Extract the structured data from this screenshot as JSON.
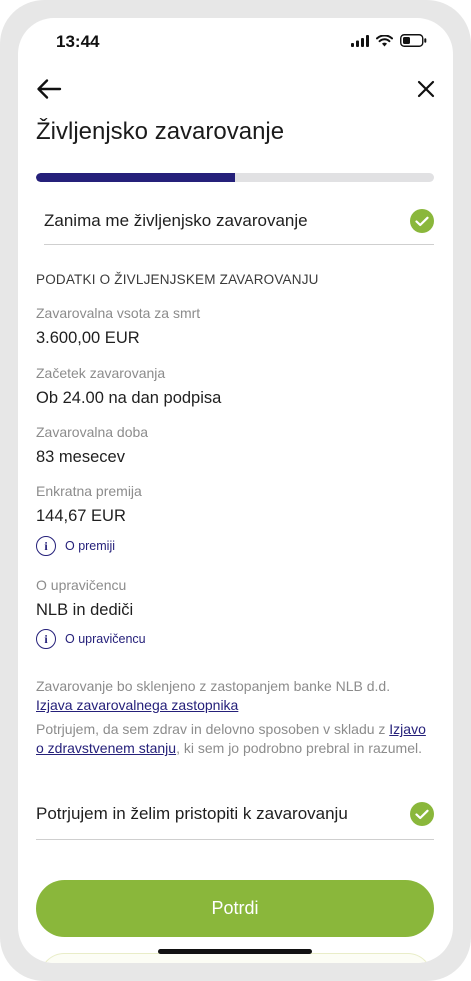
{
  "status_bar": {
    "time": "13:44"
  },
  "header": {
    "title": "Življenjsko zavarovanje"
  },
  "progress": {
    "value_percent": 50,
    "color": "#25207a",
    "track_color": "#e1e1e3"
  },
  "interest_row": {
    "label": "Zanima me življenjsko zavarovanje",
    "checked": true
  },
  "section": {
    "heading": "PODATKI O ŽIVLJENJSKEM ZAVAROVANJU"
  },
  "fields": [
    {
      "label": "Zavarovalna vsota za smrt",
      "value": "3.600,00 EUR"
    },
    {
      "label": "Začetek zavarovanja",
      "value": "Ob 24.00 na dan podpisa"
    },
    {
      "label": "Zavarovalna doba",
      "value": "83 mesecev"
    },
    {
      "label": "Enkratna premija",
      "value": "144,67 EUR"
    },
    {
      "label": "O upravičencu",
      "value": "NLB in dediči"
    }
  ],
  "info_links": {
    "premium": "O premiji",
    "beneficiary": "O upravičencu"
  },
  "disclaimer": {
    "text": "Zavarovanje bo sklenjeno z zastopanjem banke NLB d.d.",
    "link": "Izjava zavarovalnega zastopnika"
  },
  "confirmation": {
    "before": "Potrjujem, da sem zdrav in delovno sposoben v skladu z ",
    "link": "Izjavo o zdravstvenem stanju",
    "after": ", ki sem jo podrobno prebral in razumel."
  },
  "confirm_row": {
    "label": "Potrjujem in želim pristopiti k zavarovanju",
    "checked": true
  },
  "button": {
    "label": "Potrdi"
  },
  "colors": {
    "accent": "#8ab73b",
    "brand": "#25207a",
    "muted": "#8c8c8c"
  }
}
